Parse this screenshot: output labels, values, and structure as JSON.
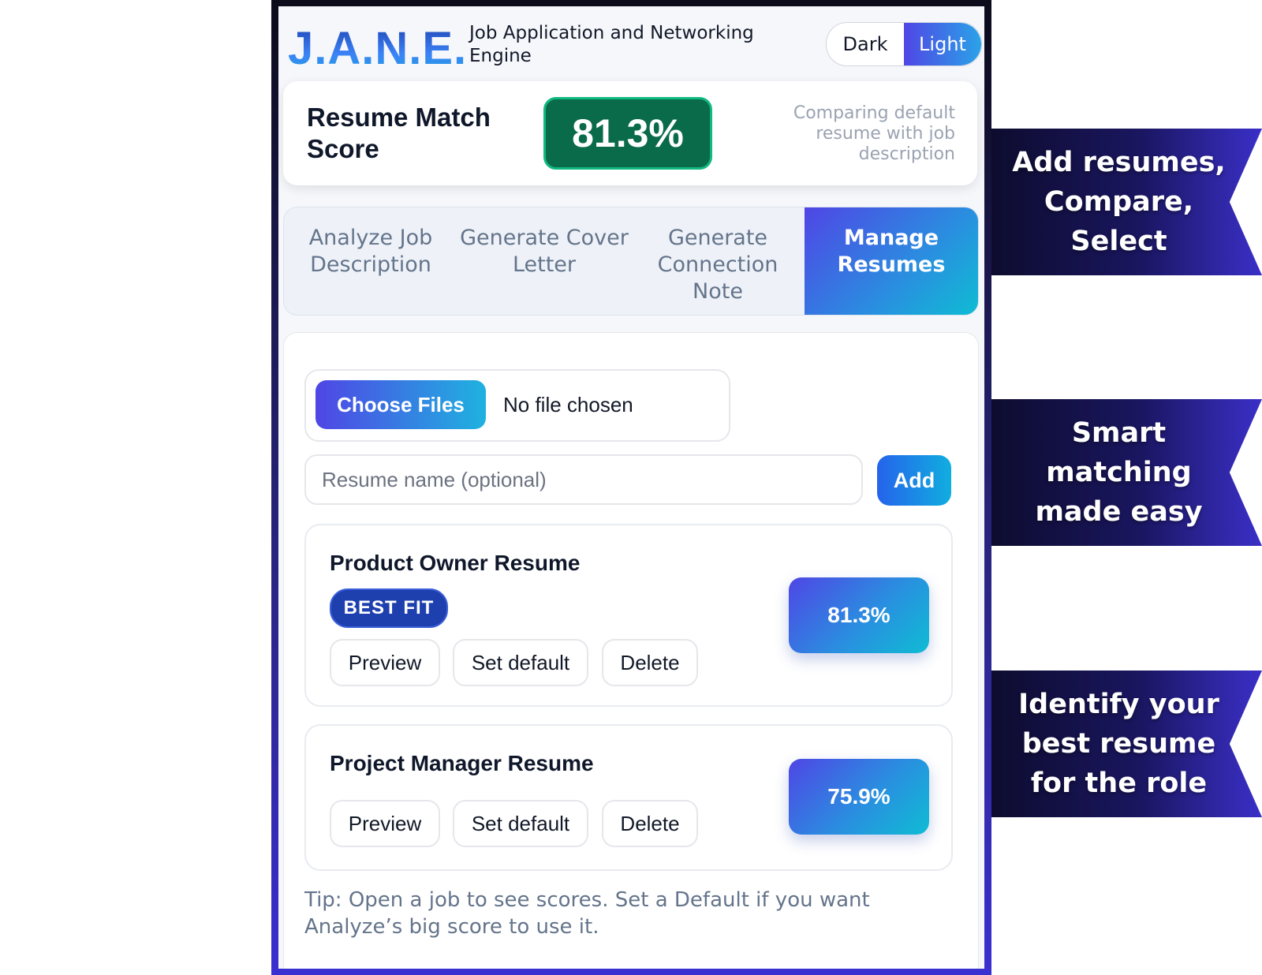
{
  "header": {
    "logo": "J.A.N.E.",
    "subtitle": "Job Application and Networking Engine",
    "theme": {
      "dark_label": "Dark",
      "light_label": "Light",
      "selected": "Light"
    }
  },
  "score_card": {
    "title": "Resume Match Score",
    "value": "81.3%",
    "note": "Comparing default resume with job description",
    "pill_color": "#0a6b4a"
  },
  "tabs": [
    {
      "label": "Analyze Job Description",
      "active": false
    },
    {
      "label": "Generate Cover Letter",
      "active": false
    },
    {
      "label": "Generate Connection Note",
      "active": false
    },
    {
      "label": "Manage Resumes",
      "active": true
    }
  ],
  "upload": {
    "choose_label": "Choose Files",
    "status": "No file chosen",
    "name_placeholder": "Resume name (optional)",
    "name_value": "",
    "add_label": "Add"
  },
  "resumes": [
    {
      "name": "Product Owner Resume",
      "badge": "BEST FIT",
      "score": "81.3%",
      "actions": {
        "preview": "Preview",
        "set_default": "Set default",
        "delete": "Delete"
      }
    },
    {
      "name": "Project Manager Resume",
      "badge": "",
      "score": "75.9%",
      "actions": {
        "preview": "Preview",
        "set_default": "Set default",
        "delete": "Delete"
      }
    }
  ],
  "tip": "Tip: Open a job to see scores. Set a Default if you want Analyze’s big score to use it.",
  "banners": [
    "Add resumes, Compare, Select",
    "Smart matching made easy",
    "Identify your best resume for the role"
  ],
  "colors": {
    "accent_gradient_start": "#4f46e5",
    "accent_gradient_end": "#0fbcd4",
    "score_green": "#0a6b4a",
    "badge_blue": "#1e40af"
  }
}
